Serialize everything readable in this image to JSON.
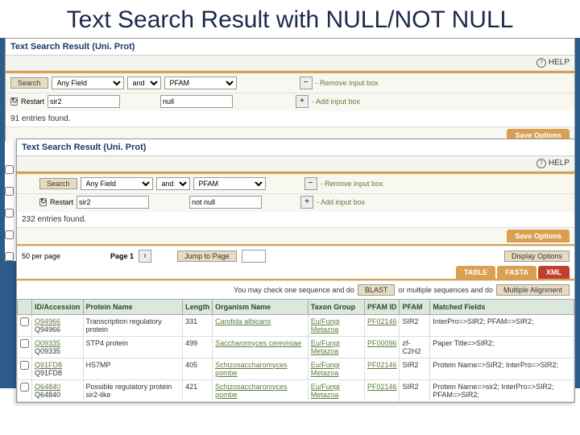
{
  "slide_title": "Text Search Result with NULL/NOT NULL",
  "panel1": {
    "header": "Text Search Result (Uni. Prot)",
    "help": "HELP",
    "search_btn": "Search",
    "restart_btn": "Restart",
    "field_sel": "Any Field",
    "op_sel": "and",
    "field2_sel": "PFAM",
    "query1": "sir2",
    "query2": "null",
    "remove_box": "- Remove input box",
    "add_box": "- Add input box",
    "entries": "91 entries found.",
    "save_options": "Save Options"
  },
  "panel2": {
    "header": "Text Search Result (Uni. Prot)",
    "help": "HELP",
    "search_btn": "Search",
    "restart_btn": "Restart",
    "field_sel": "Any Field",
    "op_sel": "and",
    "field2_sel": "PFAM",
    "query1": "sir2",
    "query2": "not null",
    "remove_box": "- Remove input box",
    "add_box": "- Add input box",
    "entries": "232 entries found.",
    "per_page": "50 per page",
    "page_lbl": "Page 1",
    "jump_lbl": "Jump to Page",
    "display_opts": "Display Options",
    "save_options": "Save Options",
    "fmt_tabs": [
      "TABLE",
      "FASTA",
      "XML"
    ],
    "blast_hint1": "You may check one sequence and do",
    "blast_btn": "BLAST",
    "blast_hint2": "or multiple sequences and do",
    "multi_btn": "Multiple Alignment",
    "cols": [
      "",
      "ID/Accession",
      "Protein Name",
      "Length",
      "Organism Name",
      "Taxon Group",
      "PFAM ID",
      "PFAM",
      "Matched Fields"
    ],
    "rows": [
      {
        "id": "Q94966",
        "acc": "Q94966",
        "protein": "Transcription regulatory protein",
        "len": "331",
        "org": "Candida albicans",
        "taxon": "Eu/Fungi Metazoa",
        "pfamid": "PF02146",
        "pfam": "SIR2",
        "matched": "InterPro=>SIR2; PFAM=>SIR2;"
      },
      {
        "id": "Q09335",
        "acc": "Q09335",
        "protein": "STP4 protein",
        "len": "499",
        "org": "Saccharomyces cerevisiae",
        "taxon": "Eu/Fungi Metazoa",
        "pfamid": "PF00096",
        "pfam": "zf-C2H2",
        "matched": "Paper Title=>SIR2;"
      },
      {
        "id": "Q91FD8",
        "acc": "Q91FD8",
        "protein": "HS7MP",
        "len": "405",
        "org": "Schizosaccharomyces pombe",
        "taxon": "Eu/Fungi Metazoa",
        "pfamid": "PF02146",
        "pfam": "SIR2",
        "matched": "Protein Name=>SIR2; InterPro=>SIR2;"
      },
      {
        "id": "Q64840",
        "acc": "Q64840",
        "protein": "Possible regulatory protein sir2-like",
        "len": "421",
        "org": "Schizosaccharomyces pombe",
        "taxon": "Eu/Fungi Metazoa",
        "pfamid": "PF02146",
        "pfam": "SIR2",
        "matched": "Protein Name=>sir2; InterPro=>SIR2; PFAM=>SIR2;"
      }
    ]
  }
}
